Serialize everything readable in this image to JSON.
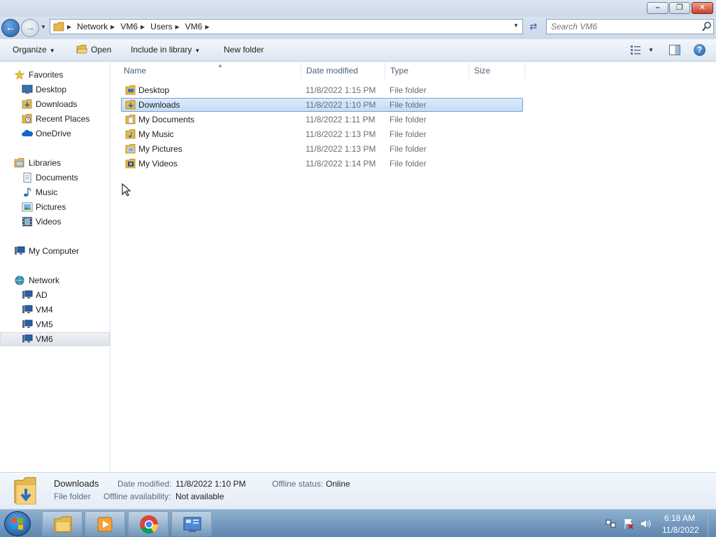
{
  "window": {
    "minimize_icon": "minimize-icon",
    "maximize_icon": "restore-icon",
    "close_icon": "close-icon"
  },
  "address": {
    "crumbs": [
      "Network",
      "VM6",
      "Users",
      "VM6"
    ],
    "search_placeholder": "Search VM6"
  },
  "toolbar": {
    "organize": "Organize",
    "open": "Open",
    "include_in_library": "Include in library",
    "new_folder": "New folder"
  },
  "nav": {
    "favorites": {
      "label": "Favorites",
      "items": [
        "Desktop",
        "Downloads",
        "Recent Places",
        "OneDrive"
      ]
    },
    "libraries": {
      "label": "Libraries",
      "items": [
        "Documents",
        "Music",
        "Pictures",
        "Videos"
      ]
    },
    "computer": {
      "label": "My Computer"
    },
    "network": {
      "label": "Network",
      "items": [
        "AD",
        "VM4",
        "VM5",
        "VM6"
      ],
      "selected": "VM6"
    }
  },
  "columns": {
    "name": "Name",
    "date_modified": "Date modified",
    "type": "Type",
    "size": "Size"
  },
  "files": [
    {
      "name": "Desktop",
      "date": "11/8/2022 1:15 PM",
      "type": "File folder",
      "icon": "desktop-folder-icon"
    },
    {
      "name": "Downloads",
      "date": "11/8/2022 1:10 PM",
      "type": "File folder",
      "icon": "downloads-folder-icon",
      "selected": true
    },
    {
      "name": "My Documents",
      "date": "11/8/2022 1:11 PM",
      "type": "File folder",
      "icon": "documents-folder-icon"
    },
    {
      "name": "My Music",
      "date": "11/8/2022 1:13 PM",
      "type": "File folder",
      "icon": "music-folder-icon"
    },
    {
      "name": "My Pictures",
      "date": "11/8/2022 1:13 PM",
      "type": "File folder",
      "icon": "pictures-folder-icon"
    },
    {
      "name": "My Videos",
      "date": "11/8/2022 1:14 PM",
      "type": "File folder",
      "icon": "videos-folder-icon"
    }
  ],
  "details": {
    "name": "Downloads",
    "kind": "File folder",
    "date_label": "Date modified:",
    "date_value": "11/8/2022 1:10 PM",
    "offline_status_label": "Offline status:",
    "offline_status_value": "Online",
    "offline_availability_label": "Offline availability:",
    "offline_availability_value": "Not available"
  },
  "taskbar": {
    "time": "6:18 AM",
    "date": "11/8/2022",
    "apps": [
      "windows-explorer-icon",
      "media-player-icon",
      "chrome-icon",
      "control-panel-icon"
    ]
  },
  "colors": {
    "selection": "#c4dcf6",
    "selection_border": "#7da2ce",
    "taskbar": "#5d86b0",
    "folder": "#f0c75e"
  }
}
